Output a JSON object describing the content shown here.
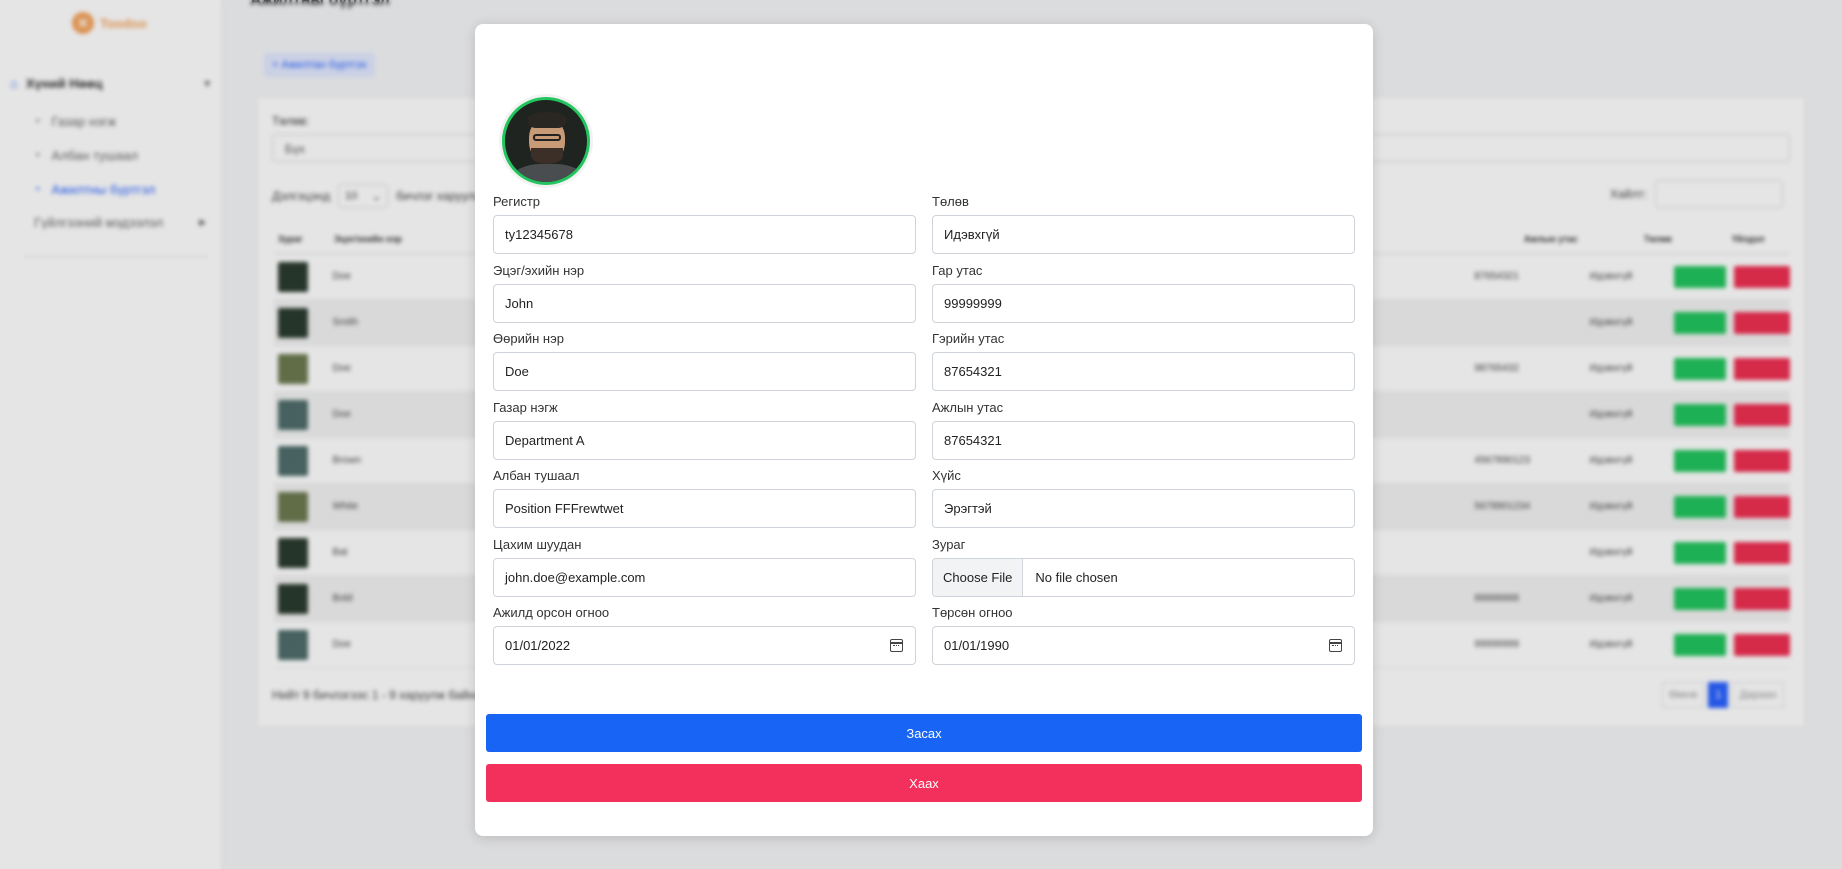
{
  "app": {
    "logo_text": "Toodoo"
  },
  "sidebar": {
    "group_label": "Хүний Нөөц",
    "items": [
      {
        "label": "Газар нэгж",
        "active": false
      },
      {
        "label": "Албан тушаал",
        "active": false
      },
      {
        "label": "Ажилтны бүртгэл",
        "active": true
      }
    ],
    "other_label": "Гүйлгээний мэдээлэл"
  },
  "background": {
    "page_title": "Ажилтны бүртгэл",
    "add_button": "+ Ажилтан бүртгэх",
    "filter_label": "Төлөв:",
    "filter_value": "Бүх",
    "length_label": "Дэлгэцэнд",
    "length_value": "10",
    "length_suffix": "бичлэг харуулах",
    "search_label": "Хайлт:",
    "columns": [
      "Зураг",
      "Эцэг/эхийн нэр",
      "Ажлын утас",
      "Төлөв",
      "Үйлдэл"
    ],
    "rows": [
      {
        "name": "Doe",
        "phone": "87654321",
        "status": "Идэвхгүй",
        "thumb": "dark"
      },
      {
        "name": "Smith",
        "phone": "",
        "status": "Идэвхгүй",
        "thumb": "dark"
      },
      {
        "name": "Doe",
        "phone": "98765432",
        "status": "Идэвхгүй",
        "thumb": "olive"
      },
      {
        "name": "Doe",
        "phone": "",
        "status": "Идэвхгүй",
        "thumb": "teal"
      },
      {
        "name": "Brown",
        "phone": "4567890123",
        "status": "Идэвхгүй",
        "thumb": "teal"
      },
      {
        "name": "White",
        "phone": "5678901234",
        "status": "Идэвхгүй",
        "thumb": "olive"
      },
      {
        "name": "Bat",
        "phone": "",
        "status": "Идэвхгүй",
        "thumb": "dark"
      },
      {
        "name": "Bold",
        "phone": "88888888",
        "status": "Идэвхгүй",
        "thumb": "dark"
      },
      {
        "name": "Doe",
        "phone": "99999999",
        "status": "Идэвхгүй",
        "thumb": "teal"
      }
    ],
    "footer_info": "Нийт 9 бичлэгээс 1 - 9 харуулж байна",
    "pager": {
      "prev": "Өмнө",
      "current": "1",
      "next": "Дараах"
    }
  },
  "modal": {
    "fields": {
      "register": {
        "label": "Регистр",
        "value": "ty12345678"
      },
      "status": {
        "label": "Төлөв",
        "value": "Идэвхгүй"
      },
      "father": {
        "label": "Эцэг/эхийн нэр",
        "value": "John"
      },
      "mobile": {
        "label": "Гар утас",
        "value": "99999999"
      },
      "lastname": {
        "label": "Өөрийн нэр",
        "value": "Doe"
      },
      "home": {
        "label": "Гэрийн утас",
        "value": "87654321"
      },
      "department": {
        "label": "Газар нэгж",
        "value": "Department A"
      },
      "workphone": {
        "label": "Ажлын утас",
        "value": "87654321"
      },
      "position": {
        "label": "Албан тушаал",
        "value": "Position FFFrewtwet"
      },
      "gender": {
        "label": "Хүйс",
        "value": "Эрэгтэй"
      },
      "email": {
        "label": "Цахим шуудан",
        "value": "john.doe@example.com"
      },
      "photo": {
        "label": "Зураг",
        "button": "Choose File",
        "value": "No file chosen"
      },
      "hire_date": {
        "label": "Ажилд орсон огноо",
        "value": "01/01/2022"
      },
      "birth_date": {
        "label": "Төрсөн огноо",
        "value": "01/01/1990"
      }
    },
    "save_label": "Засах",
    "close_label": "Хаах"
  },
  "colors": {
    "primary": "#1865f5",
    "danger": "#f32f5b",
    "success": "#22c55e"
  }
}
